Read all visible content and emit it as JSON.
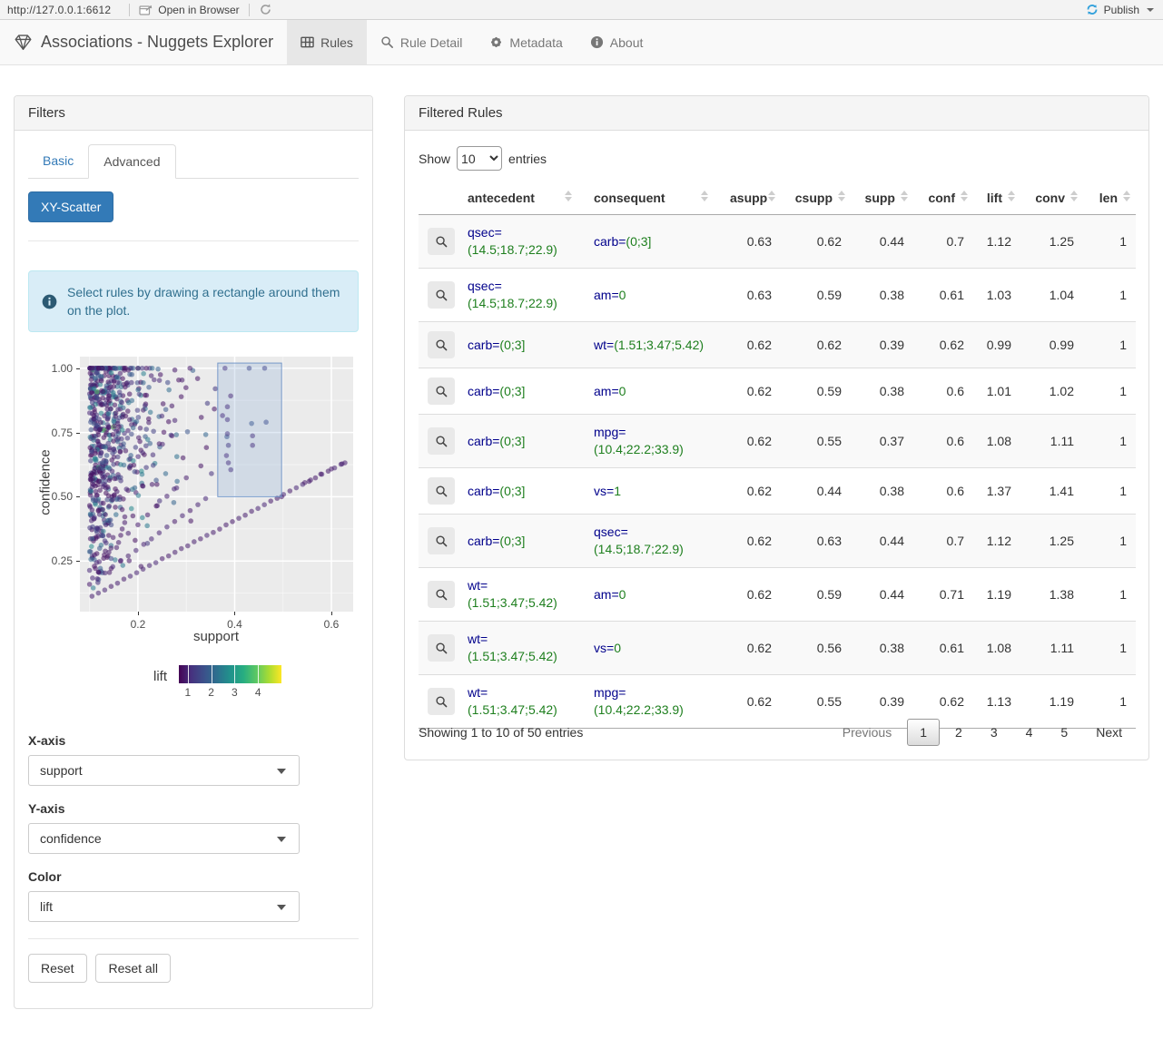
{
  "toolbar": {
    "url": "http://127.0.0.1:6612",
    "open_in_browser": "Open in Browser",
    "publish": "Publish"
  },
  "navbar": {
    "title": "Associations - Nuggets Explorer",
    "tabs": [
      {
        "label": "Rules",
        "active": true
      },
      {
        "label": "Rule Detail",
        "active": false
      },
      {
        "label": "Metadata",
        "active": false
      },
      {
        "label": "About",
        "active": false
      }
    ]
  },
  "filters": {
    "panel_title": "Filters",
    "tab_basic": "Basic",
    "tab_advanced": "Advanced",
    "scatter_button": "XY-Scatter",
    "alert_text": "Select rules by drawing a rectangle around them on the plot.",
    "xaxis_label": "X-axis",
    "xaxis_value": "support",
    "yaxis_label": "Y-axis",
    "yaxis_value": "confidence",
    "color_label": "Color",
    "color_value": "lift",
    "reset_label": "Reset",
    "reset_all_label": "Reset all"
  },
  "plot": {
    "type": "scatter",
    "xlabel": "support",
    "ylabel": "confidence",
    "x_range": [
      0.08,
      0.645
    ],
    "y_range": [
      0.053,
      1.045
    ],
    "x_ticks": [
      {
        "v": 0.2,
        "label": "0.2"
      },
      {
        "v": 0.4,
        "label": "0.4"
      },
      {
        "v": 0.6,
        "label": "0.6"
      }
    ],
    "y_ticks": [
      {
        "v": 0.25,
        "label": "0.25"
      },
      {
        "v": 0.5,
        "label": "0.50"
      },
      {
        "v": 0.75,
        "label": "0.75"
      },
      {
        "v": 1.0,
        "label": "1.00"
      }
    ],
    "x_minor": [
      0.1,
      0.3,
      0.5
    ],
    "y_minor": [
      0.125,
      0.375,
      0.625,
      0.875
    ],
    "legend": {
      "title": "lift",
      "range": [
        0.62,
        5.0
      ],
      "ticks": [
        {
          "v": 1,
          "label": "1"
        },
        {
          "v": 2,
          "label": "2"
        },
        {
          "v": 3,
          "label": "3"
        },
        {
          "v": 4,
          "label": "4"
        }
      ]
    },
    "selection": {
      "x0": 0.365,
      "x1": 0.497,
      "y0": 0.5,
      "y1": 1.02
    },
    "cloud": {
      "count": 680,
      "seed": 42,
      "s_min": 0.1,
      "s_scale": 0.052,
      "s_max": 0.46,
      "c_pow": 0.62,
      "top_frac": 0.07,
      "top_s_max": 0.47,
      "lift_base": 0.85,
      "lift_spread": 2.1,
      "lift_pow": 2.6,
      "outlier_frac": 0.015,
      "outlier_base": 3.1,
      "outlier_spread": 1.4,
      "radius": 2.8,
      "alpha": 0.55
    },
    "diagonals": [
      {
        "from": 0.105,
        "to": 0.632,
        "step": 0.0132,
        "slope": 1.0,
        "offset": 0.005
      },
      {
        "from": 0.1,
        "to": 0.345,
        "step": 0.016,
        "slope": 1.38,
        "offset": 0.02
      },
      {
        "from": 0.1,
        "to": 0.3,
        "step": 0.02,
        "slope": 1.8,
        "offset": 0.03
      }
    ],
    "extra_points": [
      [
        0.38,
        1.0,
        1.2
      ],
      [
        0.43,
        1.0,
        1.6
      ],
      [
        0.462,
        1.0,
        1.5
      ],
      [
        0.385,
        0.85,
        1.1
      ],
      [
        0.385,
        0.8,
        1.2
      ],
      [
        0.435,
        0.785,
        1.9
      ],
      [
        0.465,
        0.79,
        1.7
      ],
      [
        0.385,
        0.745,
        1.2
      ],
      [
        0.437,
        0.737,
        1.2
      ],
      [
        0.387,
        0.7,
        1.3
      ],
      [
        0.437,
        0.7,
        1.1
      ],
      [
        0.383,
        0.66,
        1.15
      ],
      [
        0.387,
        0.632,
        1.1
      ],
      [
        0.392,
        0.605,
        1.2
      ],
      [
        0.352,
        0.59,
        1.3
      ],
      [
        0.497,
        0.5,
        1.0
      ],
      [
        0.545,
        0.555,
        1.0
      ],
      [
        0.557,
        0.565,
        1.0
      ],
      [
        0.578,
        0.588,
        1.0
      ],
      [
        0.6,
        0.608,
        1.0
      ],
      [
        0.622,
        0.628,
        1.05
      ],
      [
        0.628,
        0.632,
        1.05
      ]
    ],
    "colors": {
      "panel": "#ebebeb",
      "grid_major": "rgba(255,255,255,1)",
      "grid_minor": "rgba(255,255,255,0.6)",
      "selection_fill": "rgba(120,160,210,0.22)",
      "selection_stroke": "rgba(100,140,195,0.85)"
    }
  },
  "rules": {
    "panel_title": "Filtered Rules",
    "show_label": "Show",
    "entries_label": "entries",
    "page_length": "10",
    "columns": [
      "antecedent",
      "consequent",
      "asupp",
      "csupp",
      "supp",
      "conf",
      "lift",
      "conv",
      "len"
    ],
    "rows": [
      {
        "antecedent": {
          "var": "qsec=",
          "val": "(14.5;18.7;22.9)"
        },
        "consequent": {
          "var": "carb=",
          "val": "(0;3]"
        },
        "asupp": "0.63",
        "csupp": "0.62",
        "supp": "0.44",
        "conf": "0.7",
        "lift": "1.12",
        "conv": "1.25",
        "len": "1"
      },
      {
        "antecedent": {
          "var": "qsec=",
          "val": "(14.5;18.7;22.9)"
        },
        "consequent": {
          "var": "am=",
          "val": "0"
        },
        "asupp": "0.63",
        "csupp": "0.59",
        "supp": "0.38",
        "conf": "0.61",
        "lift": "1.03",
        "conv": "1.04",
        "len": "1"
      },
      {
        "antecedent": {
          "var": "carb=",
          "val": "(0;3]"
        },
        "consequent": {
          "var": "wt=",
          "val": "(1.51;3.47;5.42)"
        },
        "asupp": "0.62",
        "csupp": "0.62",
        "supp": "0.39",
        "conf": "0.62",
        "lift": "0.99",
        "conv": "0.99",
        "len": "1"
      },
      {
        "antecedent": {
          "var": "carb=",
          "val": "(0;3]"
        },
        "consequent": {
          "var": "am=",
          "val": "0"
        },
        "asupp": "0.62",
        "csupp": "0.59",
        "supp": "0.38",
        "conf": "0.6",
        "lift": "1.01",
        "conv": "1.02",
        "len": "1"
      },
      {
        "antecedent": {
          "var": "carb=",
          "val": "(0;3]"
        },
        "consequent": {
          "var": "mpg=",
          "val": "(10.4;22.2;33.9)"
        },
        "asupp": "0.62",
        "csupp": "0.55",
        "supp": "0.37",
        "conf": "0.6",
        "lift": "1.08",
        "conv": "1.11",
        "len": "1"
      },
      {
        "antecedent": {
          "var": "carb=",
          "val": "(0;3]"
        },
        "consequent": {
          "var": "vs=",
          "val": "1"
        },
        "asupp": "0.62",
        "csupp": "0.44",
        "supp": "0.38",
        "conf": "0.6",
        "lift": "1.37",
        "conv": "1.41",
        "len": "1"
      },
      {
        "antecedent": {
          "var": "carb=",
          "val": "(0;3]"
        },
        "consequent": {
          "var": "qsec=",
          "val": "(14.5;18.7;22.9)"
        },
        "asupp": "0.62",
        "csupp": "0.63",
        "supp": "0.44",
        "conf": "0.7",
        "lift": "1.12",
        "conv": "1.25",
        "len": "1"
      },
      {
        "antecedent": {
          "var": "wt=",
          "val": "(1.51;3.47;5.42)"
        },
        "consequent": {
          "var": "am=",
          "val": "0"
        },
        "asupp": "0.62",
        "csupp": "0.59",
        "supp": "0.44",
        "conf": "0.71",
        "lift": "1.19",
        "conv": "1.38",
        "len": "1"
      },
      {
        "antecedent": {
          "var": "wt=",
          "val": "(1.51;3.47;5.42)"
        },
        "consequent": {
          "var": "vs=",
          "val": "0"
        },
        "asupp": "0.62",
        "csupp": "0.56",
        "supp": "0.38",
        "conf": "0.61",
        "lift": "1.08",
        "conv": "1.11",
        "len": "1"
      },
      {
        "antecedent": {
          "var": "wt=",
          "val": "(1.51;3.47;5.42)"
        },
        "consequent": {
          "var": "mpg=",
          "val": "(10.4;22.2;33.9)"
        },
        "asupp": "0.62",
        "csupp": "0.55",
        "supp": "0.39",
        "conf": "0.62",
        "lift": "1.13",
        "conv": "1.19",
        "len": "1"
      }
    ],
    "info": "Showing 1 to 10 of 50 entries",
    "pagination": {
      "previous": "Previous",
      "next": "Next",
      "pages": [
        "1",
        "2",
        "3",
        "4",
        "5"
      ],
      "active_page": "1"
    }
  }
}
